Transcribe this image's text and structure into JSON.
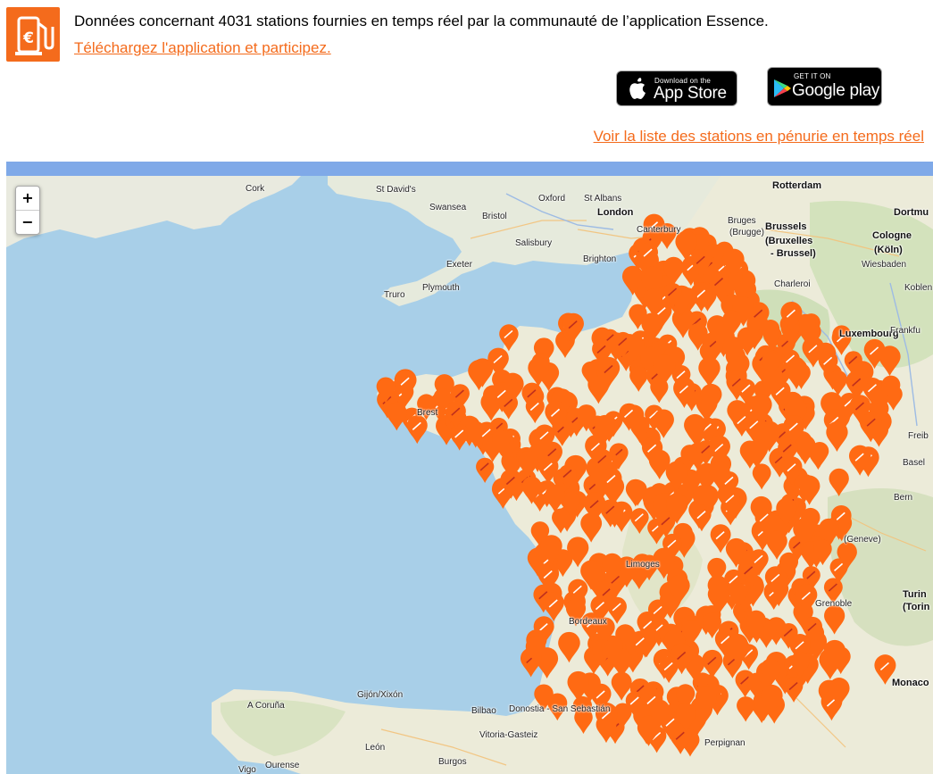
{
  "header": {
    "logo_icon": "fuel-pump-euro-icon",
    "description": "Données concernant 4031 stations fournies en temps réel par la communauté de l’application Essence.",
    "app_link": "Téléchargez l'application et participez.",
    "shortage_link": "Voir la liste des stations en pénurie en temps réel",
    "accent_color": "#f46b1c"
  },
  "badges": {
    "appstore": {
      "small": "Download on the",
      "big": "App Store",
      "icon": "apple-icon"
    },
    "google": {
      "small": "GET IT ON",
      "big": "Google play",
      "icon": "google-play-icon"
    }
  },
  "map": {
    "zoom_in": "+",
    "zoom_out": "−",
    "marker_color": "#ff6a13",
    "marker_icon": "fuel-station-marker-icon",
    "places": [
      "Cork",
      "St David's",
      "Swansea",
      "Bristol",
      "Oxford",
      "St Albans",
      "London",
      "Canterbury",
      "Salisbury",
      "Brighton",
      "Exeter",
      "Truro",
      "Plymouth",
      "Bruges",
      "(Brugge)",
      "Brussels",
      "(Bruxelles",
      "- Brussel)",
      "Rotterdam",
      "Dortmu",
      "Cologne",
      "(Köln)",
      "Wiesbaden",
      "Charleroi",
      "Koblen",
      "Luxembourg",
      "Frankfu",
      "Freib",
      "Basel",
      "Bern",
      "(Geneve)",
      "Turin",
      "(Torin",
      "Monaco",
      "Gijón/Xixón",
      "Bilbao",
      "Donostia - San Sebastián",
      "A Coruña",
      "León",
      "Vitoria-Gasteiz",
      "Burgos",
      "Ourense",
      "Vigo",
      "Perpignan",
      "Grenoble",
      "Bordeaux",
      "Limoges",
      "Brest"
    ]
  }
}
